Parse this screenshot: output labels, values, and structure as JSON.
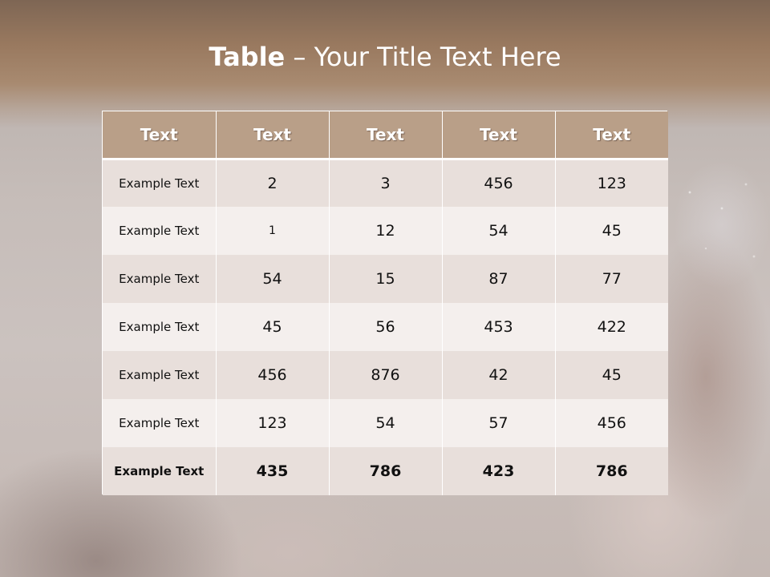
{
  "title": {
    "bold": "Table",
    "rest": " – Your Title Text Here"
  },
  "table": {
    "headers": [
      "Text",
      "Text",
      "Text",
      "Text",
      "Text"
    ],
    "rows": [
      [
        "Example Text",
        "2",
        "3",
        "456",
        "123"
      ],
      [
        "Example Text",
        "1",
        "12",
        "54",
        "45"
      ],
      [
        "Example Text",
        "54",
        "15",
        "87",
        "77"
      ],
      [
        "Example Text",
        "45",
        "56",
        "453",
        "422"
      ],
      [
        "Example Text",
        "456",
        "876",
        "42",
        "45"
      ],
      [
        "Example Text",
        "123",
        "54",
        "57",
        "456"
      ],
      [
        "Example Text",
        "435",
        "786",
        "423",
        "786"
      ]
    ]
  },
  "colors": {
    "title_band": "#99795f",
    "header_fill": "#b99f88",
    "row_odd": "#e8dfdb",
    "row_even": "#f4efed"
  }
}
